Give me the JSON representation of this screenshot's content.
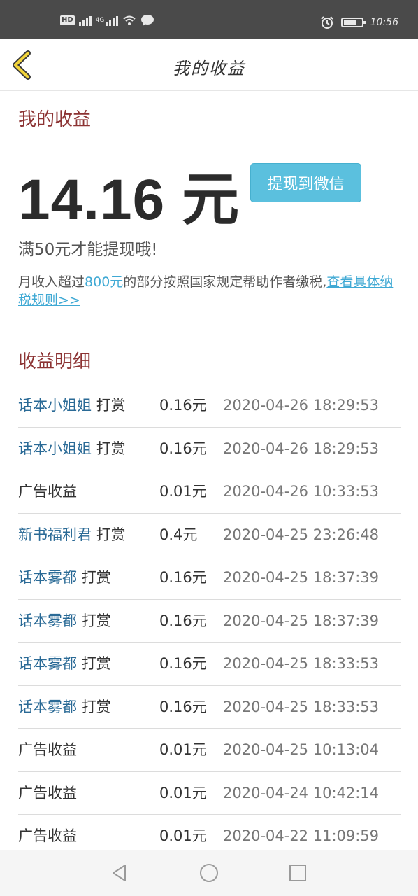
{
  "status_bar": {
    "hd_label": "HD",
    "network_label": "4G",
    "time": "10:56"
  },
  "header": {
    "title": "我的收益",
    "back_icon": "chevron-left-icon"
  },
  "earnings": {
    "section_title": "我的收益",
    "amount": "14.16 元",
    "withdraw_label": "提现到微信",
    "min_note": "满50元才能提现哦!",
    "tax_text_1": "月收入超过",
    "tax_highlight": "800元",
    "tax_text_2": "的部分按照国家规定帮助作者缴税,",
    "tax_link": "查看具体纳税规则>>"
  },
  "details": {
    "section_title": "收益明细",
    "rows": [
      {
        "name": "话本小姐姐",
        "type": "打赏",
        "amount": "0.16元",
        "time": "2020-04-26 18:29:53"
      },
      {
        "name": "话本小姐姐",
        "type": "打赏",
        "amount": "0.16元",
        "time": "2020-04-26 18:29:53"
      },
      {
        "name": "",
        "type": "广告收益",
        "amount": "0.01元",
        "time": "2020-04-26 10:33:53"
      },
      {
        "name": "新书福利君",
        "type": "打赏",
        "amount": "0.4元",
        "time": "2020-04-25 23:26:48"
      },
      {
        "name": "话本雾都",
        "type": "打赏",
        "amount": "0.16元",
        "time": "2020-04-25 18:37:39"
      },
      {
        "name": "话本雾都",
        "type": "打赏",
        "amount": "0.16元",
        "time": "2020-04-25 18:37:39"
      },
      {
        "name": "话本雾都",
        "type": "打赏",
        "amount": "0.16元",
        "time": "2020-04-25 18:33:53"
      },
      {
        "name": "话本雾都",
        "type": "打赏",
        "amount": "0.16元",
        "time": "2020-04-25 18:33:53"
      },
      {
        "name": "",
        "type": "广告收益",
        "amount": "0.01元",
        "time": "2020-04-25 10:13:04"
      },
      {
        "name": "",
        "type": "广告收益",
        "amount": "0.01元",
        "time": "2020-04-24 10:42:14"
      },
      {
        "name": "",
        "type": "广告收益",
        "amount": "0.01元",
        "time": "2020-04-22 11:09:59"
      }
    ]
  },
  "colors": {
    "section_title": "#8c3333",
    "accent": "#5bc0de",
    "link": "#3fa9d4",
    "name": "#2a6a96",
    "back_chevron": "#f2d43a"
  },
  "nav_bar": {
    "icons": [
      "back-triangle-icon",
      "home-circle-icon",
      "recents-square-icon"
    ]
  }
}
